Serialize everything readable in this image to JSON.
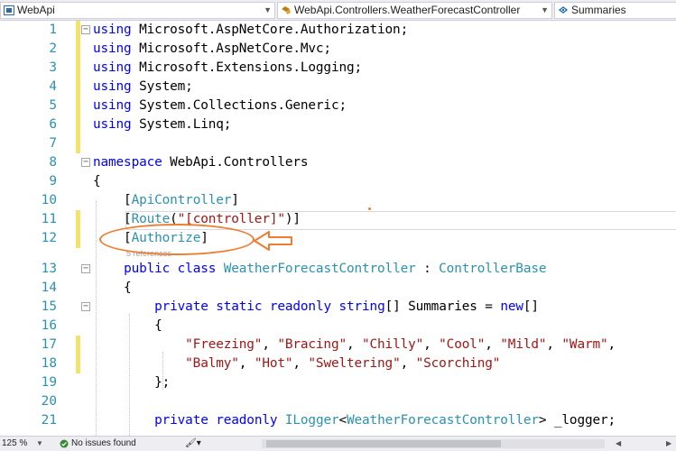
{
  "nav": {
    "project": "WebApi",
    "type": "WebApi.Controllers.WeatherForecastController",
    "member": "Summaries",
    "project_icon": "csharp-project-icon",
    "type_icon": "class-icon",
    "member_icon": "field-icon"
  },
  "editor": {
    "line_numbers": [
      "1",
      "2",
      "3",
      "4",
      "5",
      "6",
      "7",
      "8",
      "9",
      "10",
      "11",
      "12",
      "13",
      "14",
      "15",
      "16",
      "17",
      "18",
      "19",
      "20",
      "21"
    ],
    "codelens": "5 references"
  },
  "statusbar": {
    "zoom": "125 %",
    "issues": "No issues found",
    "tools_icon": "brush-icon"
  },
  "colors": {
    "keyword": "#0000ff",
    "type": "#2b91af",
    "string": "#a31515",
    "annotation": "#ed7d31",
    "change_marker": "#f2e36c"
  }
}
